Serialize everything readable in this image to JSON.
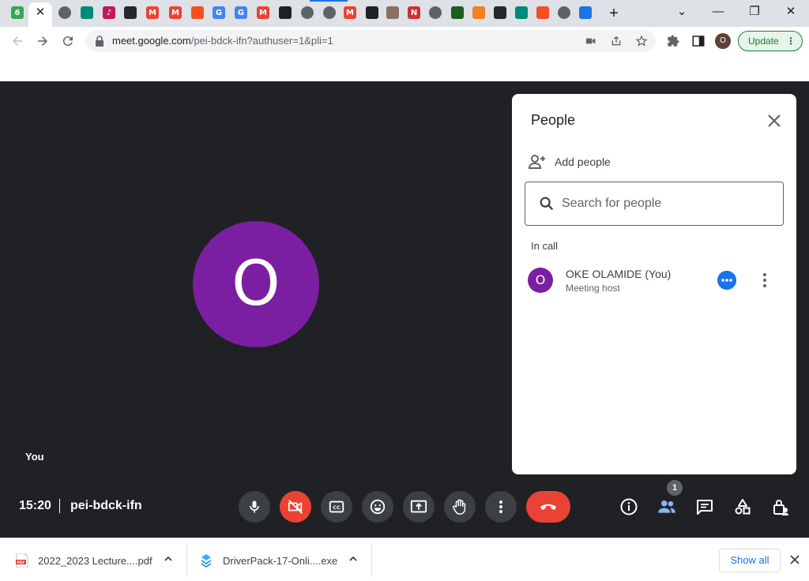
{
  "tabs": [
    {
      "icon": "badge-6-icon",
      "color": "#34a853",
      "glyph": "6"
    },
    {
      "icon": "globe-icon",
      "color": "#5f6368",
      "glyph": ""
    },
    {
      "icon": "google-meet-icon",
      "color": "#00897b",
      "glyph": ""
    },
    {
      "icon": "music-icon",
      "color": "#c2185b",
      "glyph": "♪"
    },
    {
      "icon": "github-icon",
      "color": "#24292e",
      "glyph": ""
    },
    {
      "icon": "gmail-icon",
      "color": "#ea4335",
      "glyph": "M"
    },
    {
      "icon": "gmail-icon",
      "color": "#ea4335",
      "glyph": "M"
    },
    {
      "icon": "orange-circle-icon",
      "color": "#f4511e",
      "glyph": ""
    },
    {
      "icon": "google-icon",
      "color": "#4285f4",
      "glyph": "G"
    },
    {
      "icon": "google-icon",
      "color": "#4285f4",
      "glyph": "G"
    },
    {
      "icon": "gmail-icon",
      "color": "#ea4335",
      "glyph": "M"
    },
    {
      "icon": "dark-square-icon",
      "color": "#202124",
      "glyph": ""
    },
    {
      "icon": "globe-icon",
      "color": "#5f6368",
      "glyph": ""
    },
    {
      "icon": "globe-icon",
      "color": "#5f6368",
      "glyph": ""
    },
    {
      "icon": "gmail-icon",
      "color": "#ea4335",
      "glyph": "M"
    },
    {
      "icon": "dark-square-icon",
      "color": "#202124",
      "glyph": ""
    },
    {
      "icon": "coffee-icon",
      "color": "#8d6e63",
      "glyph": ""
    },
    {
      "icon": "red-square-icon",
      "color": "#d32f2f",
      "glyph": "N"
    },
    {
      "icon": "chrome-icon",
      "color": "#5f6368",
      "glyph": ""
    },
    {
      "icon": "green-leaf-icon",
      "color": "#1b5e20",
      "glyph": ""
    },
    {
      "icon": "stack-icon",
      "color": "#f48024",
      "glyph": ""
    },
    {
      "icon": "github-icon",
      "color": "#24292e",
      "glyph": ""
    },
    {
      "icon": "google-meet-icon",
      "color": "#00897b",
      "glyph": ""
    },
    {
      "icon": "microsoft-icon",
      "color": "#f25022",
      "glyph": ""
    },
    {
      "icon": "globe-icon",
      "color": "#5f6368",
      "glyph": ""
    },
    {
      "icon": "download-icon",
      "color": "#1a73e8",
      "glyph": ""
    }
  ],
  "address_bar": {
    "host": "meet.google.com",
    "path": "/pei-bdck-ifn?authuser=1&pli=1"
  },
  "profile_initial": "O",
  "update_label": "Update",
  "meet": {
    "avatar_initial": "O",
    "self_label": "You",
    "time": "15:20",
    "meeting_code": "pei-bdck-ifn",
    "participant_count": "1"
  },
  "people_panel": {
    "title": "People",
    "add_people_label": "Add people",
    "search_placeholder": "Search for people",
    "section_label": "In call",
    "participants": [
      {
        "initial": "O",
        "name": "OKE OLAMIDE (You)",
        "role": "Meeting host",
        "avatar_color": "#7b1fa2"
      }
    ]
  },
  "downloads": [
    {
      "name": "2022_2023 Lecture....pdf",
      "icon": "pdf-file-icon"
    },
    {
      "name": "DriverPack-17-Onli....exe",
      "icon": "exe-file-icon"
    }
  ],
  "show_all_label": "Show all",
  "colors": {
    "meet_bg": "#202124",
    "avatar": "#7b1fa2",
    "end_call": "#ea4335",
    "accent": "#1a73e8"
  }
}
